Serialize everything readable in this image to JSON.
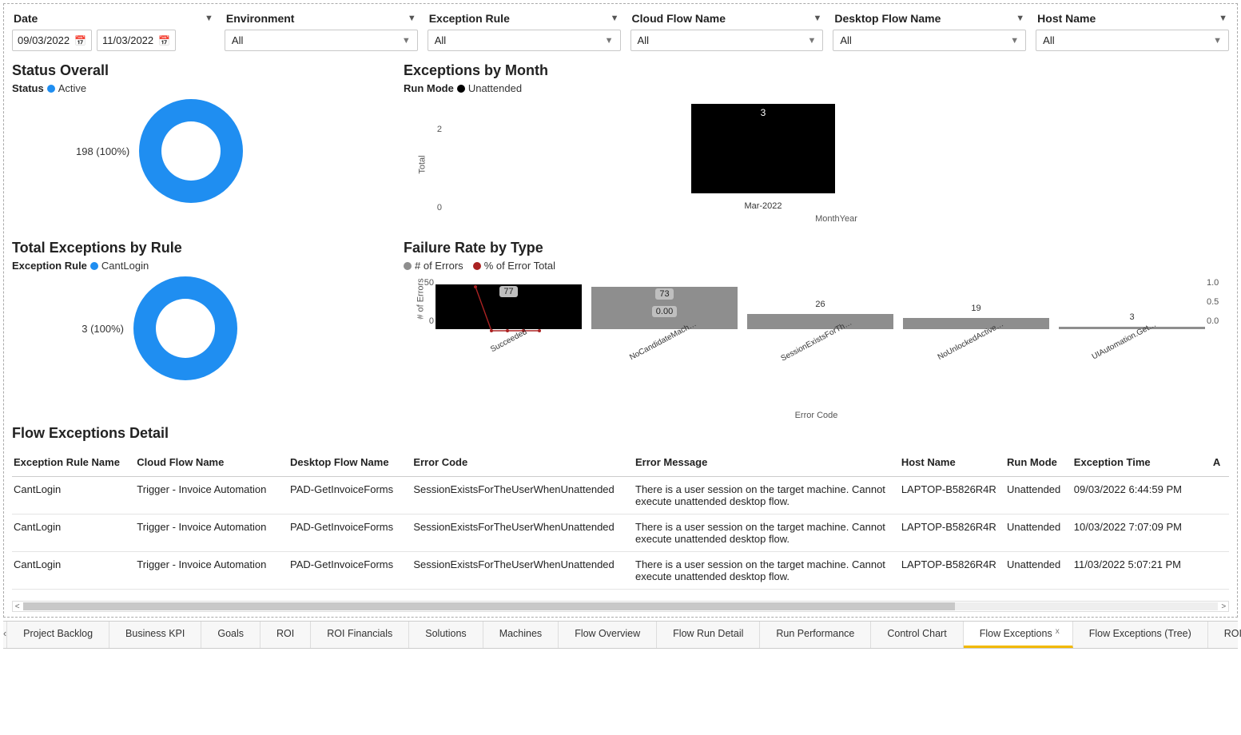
{
  "filters": {
    "date": {
      "label": "Date",
      "start": "09/03/2022",
      "end": "11/03/2022"
    },
    "environment": {
      "label": "Environment",
      "value": "All"
    },
    "exceptionRule": {
      "label": "Exception Rule",
      "value": "All"
    },
    "cloudFlow": {
      "label": "Cloud Flow Name",
      "value": "All"
    },
    "desktopFlow": {
      "label": "Desktop Flow Name",
      "value": "All"
    },
    "hostName": {
      "label": "Host Name",
      "value": "All"
    }
  },
  "statusOverall": {
    "title": "Status Overall",
    "legendField": "Status",
    "legendValue": "Active",
    "label": "198 (100%)"
  },
  "totalExceptions": {
    "title": "Total Exceptions by Rule",
    "legendField": "Exception Rule",
    "legendValue": "CantLogin",
    "label": "3 (100%)"
  },
  "exceptionsByMonth": {
    "title": "Exceptions by Month",
    "legendField": "Run Mode",
    "legendValue": "Unattended",
    "yLabel": "Total",
    "xTitle": "MonthYear",
    "tick0": "0",
    "tick2": "2",
    "barLabel": "3",
    "barCat": "Mar-2022"
  },
  "failureRate": {
    "title": "Failure Rate by Type",
    "legend1": "# of Errors",
    "legend2": "% of Error Total",
    "yLeftLabel": "# of Errors",
    "xTitle": "Error Code",
    "yLeftTicks": [
      "50",
      "0"
    ],
    "yRightTicks": [
      "1.0",
      "0.5",
      "0.0"
    ],
    "bars": [
      {
        "cat": "Succeeded",
        "val": "77"
      },
      {
        "cat": "NoCandidateMach…",
        "val": "73",
        "sub": "0.00"
      },
      {
        "cat": "SessionExistsForTh…",
        "val": "26"
      },
      {
        "cat": "NoUnlockedActive…",
        "val": "19"
      },
      {
        "cat": "UIAutomation.Get…",
        "val": "3"
      }
    ]
  },
  "detail": {
    "title": "Flow Exceptions Detail",
    "headers": {
      "exc": "Exception Rule Name",
      "cloud": "Cloud Flow Name",
      "desk": "Desktop Flow Name",
      "code": "Error Code",
      "msg": "Error Message",
      "host": "Host Name",
      "mode": "Run Mode",
      "time": "Exception Time",
      "a": "A"
    },
    "rows": [
      {
        "exc": "CantLogin",
        "cloud": "Trigger - Invoice Automation",
        "desk": "PAD-GetInvoiceForms",
        "code": "SessionExistsForTheUserWhenUnattended",
        "msg": "There is a user session on the target machine. Cannot execute unattended desktop flow.",
        "host": "LAPTOP-B5826R4R",
        "mode": "Unattended",
        "time": "09/03/2022 6:44:59 PM"
      },
      {
        "exc": "CantLogin",
        "cloud": "Trigger - Invoice Automation",
        "desk": "PAD-GetInvoiceForms",
        "code": "SessionExistsForTheUserWhenUnattended",
        "msg": "There is a user session on the target machine. Cannot execute unattended desktop flow.",
        "host": "LAPTOP-B5826R4R",
        "mode": "Unattended",
        "time": "10/03/2022 7:07:09 PM"
      },
      {
        "exc": "CantLogin",
        "cloud": "Trigger - Invoice Automation",
        "desk": "PAD-GetInvoiceForms",
        "code": "SessionExistsForTheUserWhenUnattended",
        "msg": "There is a user session on the target machine. Cannot execute unattended desktop flow.",
        "host": "LAPTOP-B5826R4R",
        "mode": "Unattended",
        "time": "11/03/2022 5:07:21 PM"
      }
    ]
  },
  "tabs": [
    "Project Backlog",
    "Business KPI",
    "Goals",
    "ROI",
    "ROI Financials",
    "Solutions",
    "Machines",
    "Flow Overview",
    "Flow Run Detail",
    "Run Performance",
    "Control Chart",
    "Flow Exceptions",
    "Flow Exceptions (Tree)",
    "ROI Calculations"
  ],
  "activeTab": "Flow Exceptions",
  "chart_data": [
    {
      "type": "pie",
      "title": "Status Overall",
      "series": [
        {
          "name": "Active",
          "value": 198,
          "pct": 100
        }
      ],
      "legend_field": "Status"
    },
    {
      "type": "pie",
      "title": "Total Exceptions by Rule",
      "series": [
        {
          "name": "CantLogin",
          "value": 3,
          "pct": 100
        }
      ],
      "legend_field": "Exception Rule"
    },
    {
      "type": "bar",
      "title": "Exceptions by Month",
      "legend_field": "Run Mode",
      "legend_value": "Unattended",
      "categories": [
        "Mar-2022"
      ],
      "values": [
        3
      ],
      "xlabel": "MonthYear",
      "ylabel": "Total",
      "ylim": [
        0,
        3
      ]
    },
    {
      "type": "bar",
      "title": "Failure Rate by Type",
      "categories": [
        "Succeeded",
        "NoCandidateMach…",
        "SessionExistsForTh…",
        "NoUnlockedActive…",
        "UIAutomation.Get…"
      ],
      "series": [
        {
          "name": "# of Errors",
          "values": [
            77,
            73,
            26,
            19,
            3
          ],
          "axis": "left"
        },
        {
          "name": "% of Error Total",
          "values": [
            null,
            0.0,
            null,
            null,
            null
          ],
          "axis": "right",
          "type": "line"
        }
      ],
      "xlabel": "Error Code",
      "ylabel": "# of Errors",
      "ylim_left": [
        0,
        77
      ],
      "ylim_right": [
        0.0,
        1.0
      ]
    }
  ]
}
